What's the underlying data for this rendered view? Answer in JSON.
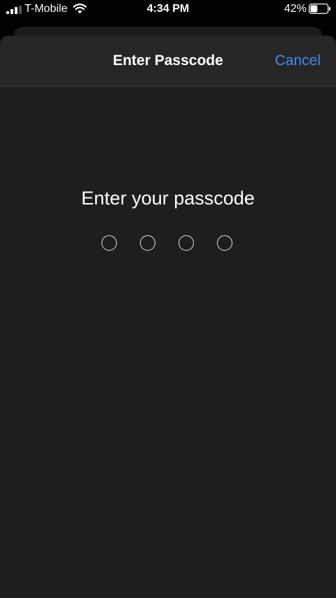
{
  "status_bar": {
    "carrier": "T-Mobile",
    "time": "4:34 PM",
    "battery_percent": "42%",
    "battery_level": 0.42,
    "signal_bars": 3,
    "signal_icon": "cellular-signal-icon",
    "wifi_icon": "wifi-icon",
    "battery_icon": "battery-icon"
  },
  "nav": {
    "title": "Enter Passcode",
    "cancel_label": "Cancel"
  },
  "passcode": {
    "prompt": "Enter your passcode",
    "length": 4,
    "entered": 0
  },
  "colors": {
    "accent": "#3e8df0",
    "sheet_background": "#1e1e1e",
    "nav_background": "#262626"
  }
}
